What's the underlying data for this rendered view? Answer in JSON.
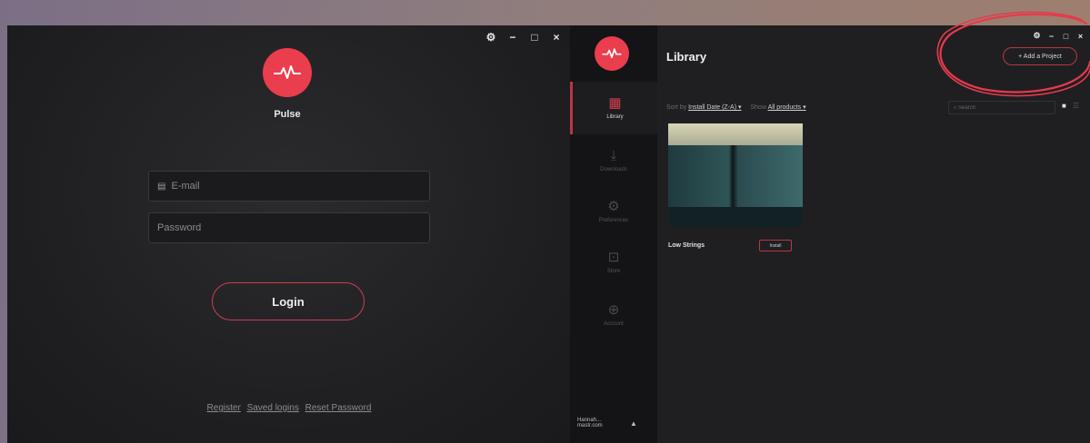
{
  "login": {
    "window_controls": {
      "settings": "⚙",
      "minimize": "−",
      "maximize": "□",
      "close": "×"
    },
    "app_name": "Pulse",
    "email_placeholder": "E-mail",
    "password_placeholder": "Password",
    "login_label": "Login",
    "links": {
      "register": "Register",
      "saved_logins": "Saved logins",
      "reset_password": "Reset Password"
    }
  },
  "library": {
    "window_controls": {
      "settings": "⚙",
      "minimize": "−",
      "maximize": "□",
      "close": "×"
    },
    "title": "Library",
    "add_project_label": "+ Add a Project",
    "sidebar": {
      "library": "Library",
      "downloads": "Downloads",
      "settings": "Preferences",
      "store": "Store",
      "account": "Account",
      "user": "Hannah... mastr.com"
    },
    "filters": {
      "sort_label": "Sort by",
      "sort_value": "Install Date (Z-A) ▾",
      "show_label": "Show",
      "show_value": "All products ▾"
    },
    "search_placeholder": "⌕ Search",
    "products": [
      {
        "name": "Low Strings",
        "action_label": "Install"
      }
    ]
  },
  "colors": {
    "accent": "#ea3d4e",
    "background_dark": "#1f1f22",
    "sidebar": "#141416"
  }
}
